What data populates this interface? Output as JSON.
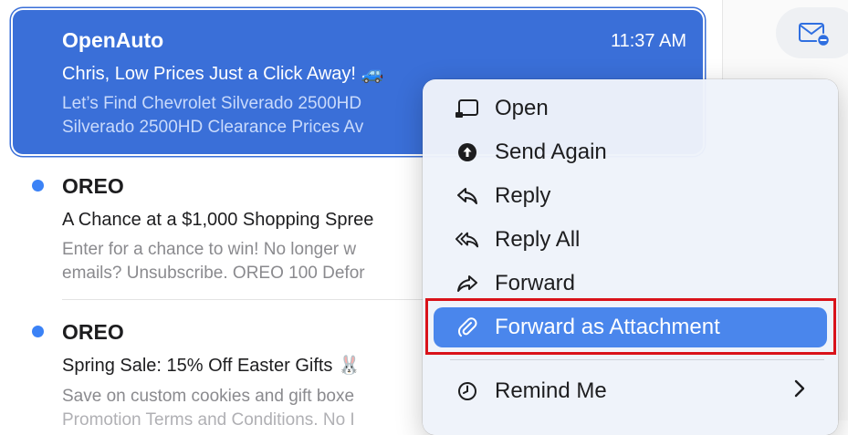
{
  "emails": [
    {
      "sender": "OpenAuto",
      "time": "11:37 AM",
      "subject": "Chris, Low Prices Just a Click Away! 🚙",
      "preview_line1": "Let’s Find Chevrolet Silverado 2500HD",
      "preview_line2": "Silverado 2500HD Clearance Prices Av",
      "selected": true,
      "unread": false
    },
    {
      "sender": "OREO",
      "subject": "A Chance at a $1,000 Shopping Spree",
      "preview_line1": "Enter for a chance to win! No longer w",
      "preview_line2": "emails? Unsubscribe. OREO 100 Defor",
      "selected": false,
      "unread": true
    },
    {
      "sender": "OREO",
      "subject": "Spring Sale: 15% Off Easter Gifts 🐰",
      "preview_line1": "Save on custom cookies and gift boxe",
      "preview_line2": "Promotion Terms and Conditions. No I",
      "selected": false,
      "unread": true
    }
  ],
  "toolbar": {
    "mail_action_icon": "envelope-minus-icon"
  },
  "context_menu": {
    "items": [
      {
        "label": "Open",
        "icon": "open-window-icon"
      },
      {
        "label": "Send Again",
        "icon": "arrow-up-circle-icon"
      },
      {
        "label": "Reply",
        "icon": "reply-icon"
      },
      {
        "label": "Reply All",
        "icon": "reply-all-icon"
      },
      {
        "label": "Forward",
        "icon": "forward-icon"
      },
      {
        "label": "Forward as Attachment",
        "icon": "paperclip-icon",
        "highlighted": true
      },
      {
        "label": "Remind Me",
        "icon": "clock-icon",
        "has_submenu": true
      }
    ]
  },
  "colors": {
    "selection": "#3a6fd8",
    "highlight": "#4a86ec",
    "unread_dot": "#3b82f6",
    "annotation_box": "#d9121a"
  }
}
